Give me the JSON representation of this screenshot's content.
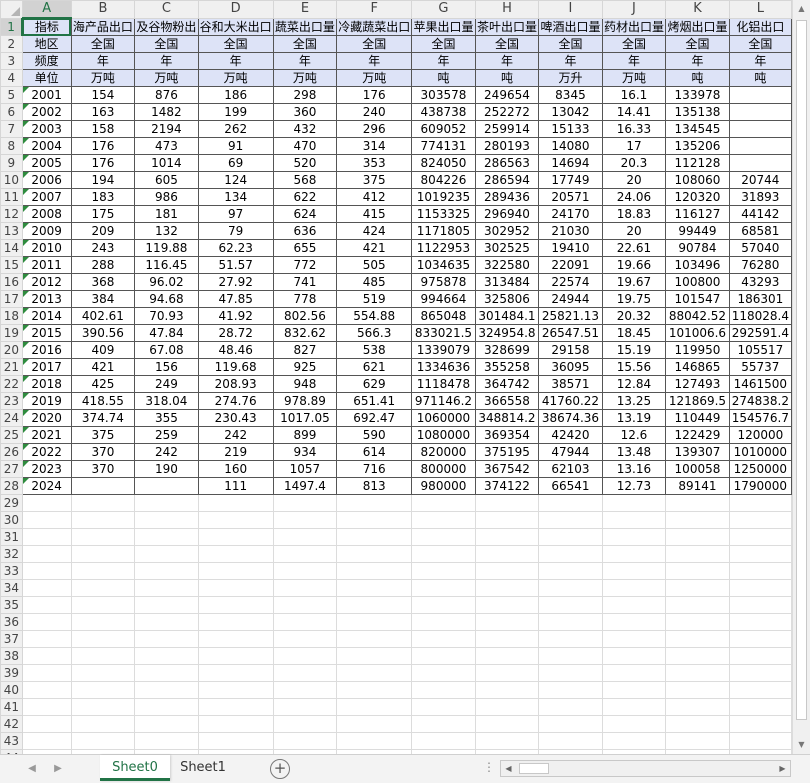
{
  "columns": [
    "A",
    "B",
    "C",
    "D",
    "E",
    "F",
    "G",
    "H",
    "I",
    "J",
    "K",
    "L"
  ],
  "header_rows": [
    [
      "指标",
      "海产品出口",
      "及谷物粉出",
      "谷和大米出口",
      "蔬菜出口量",
      "冷藏蔬菜出口",
      "苹果出口量",
      "茶叶出口量",
      "啤酒出口量",
      "药材出口量",
      "烤烟出口量",
      "化铝出口"
    ],
    [
      "地区",
      "全国",
      "全国",
      "全国",
      "全国",
      "全国",
      "全国",
      "全国",
      "全国",
      "全国",
      "全国",
      "全国"
    ],
    [
      "频度",
      "年",
      "年",
      "年",
      "年",
      "年",
      "年",
      "年",
      "年",
      "年",
      "年",
      "年"
    ],
    [
      "单位",
      "万吨",
      "万吨",
      "万吨",
      "万吨",
      "万吨",
      "吨",
      "吨",
      "万升",
      "万吨",
      "吨",
      "吨"
    ]
  ],
  "data_rows": [
    [
      "2001",
      "154",
      "876",
      "186",
      "298",
      "176",
      "303578",
      "249654",
      "8345",
      "16.1",
      "133978",
      ""
    ],
    [
      "2002",
      "163",
      "1482",
      "199",
      "360",
      "240",
      "438738",
      "252272",
      "13042",
      "14.41",
      "135138",
      ""
    ],
    [
      "2003",
      "158",
      "2194",
      "262",
      "432",
      "296",
      "609052",
      "259914",
      "15133",
      "16.33",
      "134545",
      ""
    ],
    [
      "2004",
      "176",
      "473",
      "91",
      "470",
      "314",
      "774131",
      "280193",
      "14080",
      "17",
      "135206",
      ""
    ],
    [
      "2005",
      "176",
      "1014",
      "69",
      "520",
      "353",
      "824050",
      "286563",
      "14694",
      "20.3",
      "112128",
      ""
    ],
    [
      "2006",
      "194",
      "605",
      "124",
      "568",
      "375",
      "804226",
      "286594",
      "17749",
      "20",
      "108060",
      "20744"
    ],
    [
      "2007",
      "183",
      "986",
      "134",
      "622",
      "412",
      "1019235",
      "289436",
      "20571",
      "24.06",
      "120320",
      "31893"
    ],
    [
      "2008",
      "175",
      "181",
      "97",
      "624",
      "415",
      "1153325",
      "296940",
      "24170",
      "18.83",
      "116127",
      "44142"
    ],
    [
      "2009",
      "209",
      "132",
      "79",
      "636",
      "424",
      "1171805",
      "302952",
      "21030",
      "20",
      "99449",
      "68581"
    ],
    [
      "2010",
      "243",
      "119.88",
      "62.23",
      "655",
      "421",
      "1122953",
      "302525",
      "19410",
      "22.61",
      "90784",
      "57040"
    ],
    [
      "2011",
      "288",
      "116.45",
      "51.57",
      "772",
      "505",
      "1034635",
      "322580",
      "22091",
      "19.66",
      "103496",
      "76280"
    ],
    [
      "2012",
      "368",
      "96.02",
      "27.92",
      "741",
      "485",
      "975878",
      "313484",
      "22574",
      "19.67",
      "100800",
      "43293"
    ],
    [
      "2013",
      "384",
      "94.68",
      "47.85",
      "778",
      "519",
      "994664",
      "325806",
      "24944",
      "19.75",
      "101547",
      "186301"
    ],
    [
      "2014",
      "402.61",
      "70.93",
      "41.92",
      "802.56",
      "554.88",
      "865048",
      "301484.1",
      "25821.13",
      "20.32",
      "88042.52",
      "118028.4"
    ],
    [
      "2015",
      "390.56",
      "47.84",
      "28.72",
      "832.62",
      "566.3",
      "833021.5",
      "324954.8",
      "26547.51",
      "18.45",
      "101006.6",
      "292591.4"
    ],
    [
      "2016",
      "409",
      "67.08",
      "48.46",
      "827",
      "538",
      "1339079",
      "328699",
      "29158",
      "15.19",
      "119950",
      "105517"
    ],
    [
      "2017",
      "421",
      "156",
      "119.68",
      "925",
      "621",
      "1334636",
      "355258",
      "36095",
      "15.56",
      "146865",
      "55737"
    ],
    [
      "2018",
      "425",
      "249",
      "208.93",
      "948",
      "629",
      "1118478",
      "364742",
      "38571",
      "12.84",
      "127493",
      "1461500"
    ],
    [
      "2019",
      "418.55",
      "318.04",
      "274.76",
      "978.89",
      "651.41",
      "971146.2",
      "366558",
      "41760.22",
      "13.25",
      "121869.5",
      "274838.2"
    ],
    [
      "2020",
      "374.74",
      "355",
      "230.43",
      "1017.05",
      "692.47",
      "1060000",
      "348814.2",
      "38674.36",
      "13.19",
      "110449",
      "154576.7"
    ],
    [
      "2021",
      "375",
      "259",
      "242",
      "899",
      "590",
      "1080000",
      "369354",
      "42420",
      "12.6",
      "122429",
      "120000"
    ],
    [
      "2022",
      "370",
      "242",
      "219",
      "934",
      "614",
      "820000",
      "375195",
      "47944",
      "13.48",
      "139307",
      "1010000"
    ],
    [
      "2023",
      "370",
      "190",
      "160",
      "1057",
      "716",
      "800000",
      "367542",
      "62103",
      "13.16",
      "100058",
      "1250000"
    ],
    [
      "2024",
      "",
      "",
      "111",
      "1497.4",
      "813",
      "980000",
      "374122",
      "66541",
      "12.73",
      "89141",
      "1790000"
    ]
  ],
  "empty_row_numbers": [
    29,
    30,
    31,
    32,
    33,
    34,
    35,
    36,
    37,
    38,
    39,
    40,
    41,
    42,
    43,
    44
  ],
  "sheet_tabs": [
    "Sheet0",
    "Sheet1"
  ],
  "active_tab": "Sheet0",
  "add_sheet_label": "+",
  "dots_label": "⋮",
  "icons": {
    "prev_sheet": "triangle-left-icon",
    "next_sheet": "triangle-right-icon",
    "add_sheet": "plus-circle-icon"
  },
  "colors": {
    "accent": "#217346",
    "header_fill": "#dde3f7",
    "error_triangle": "#2e8b3e"
  }
}
